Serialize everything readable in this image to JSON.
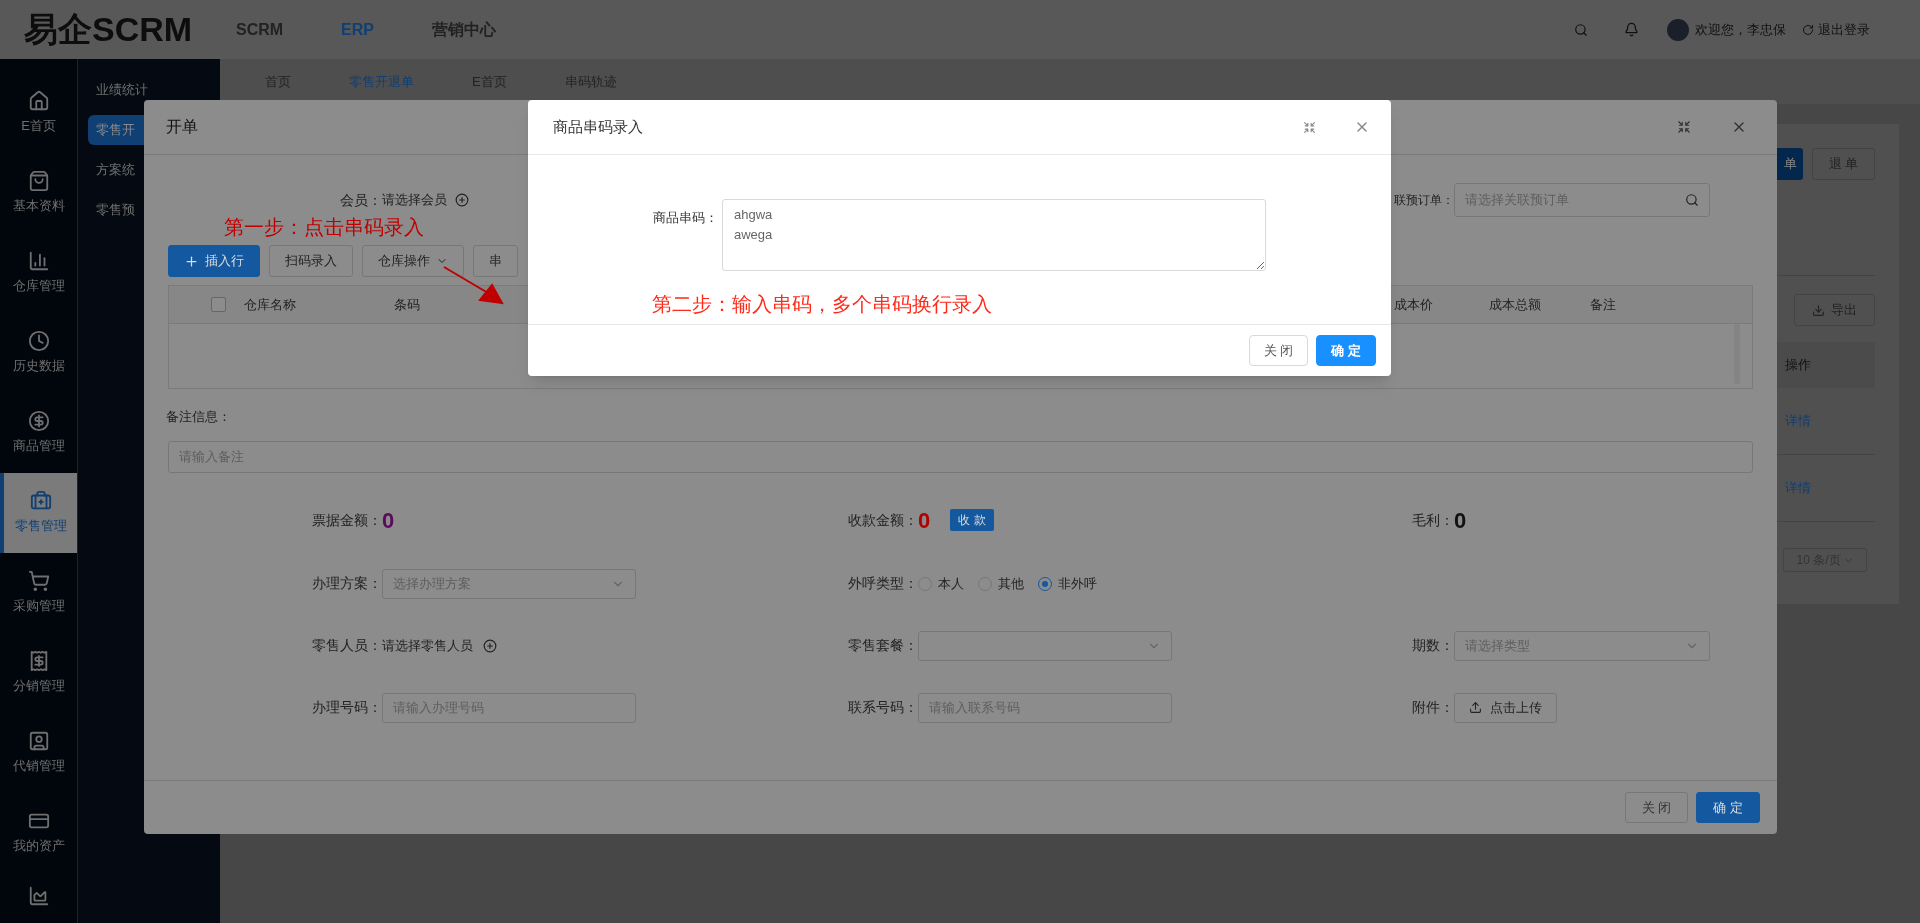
{
  "top_bar": {
    "logo": "易企SCRM",
    "nav": [
      {
        "label": "SCRM",
        "selected": false
      },
      {
        "label": "ERP",
        "selected": true
      },
      {
        "label": "营销中心",
        "selected": false
      }
    ],
    "greeting": "欢迎您，李忠保",
    "logout": "退出登录"
  },
  "sidebar": {
    "items": [
      {
        "label": "E首页",
        "selected": false
      },
      {
        "label": "基本资料",
        "selected": false
      },
      {
        "label": "仓库管理",
        "selected": false
      },
      {
        "label": "历史数据",
        "selected": false
      },
      {
        "label": "商品管理",
        "selected": false
      },
      {
        "label": "零售管理",
        "selected": true
      },
      {
        "label": "采购管理",
        "selected": false
      },
      {
        "label": "分销管理",
        "selected": false
      },
      {
        "label": "代销管理",
        "selected": false
      },
      {
        "label": "我的资产",
        "selected": false
      }
    ]
  },
  "sub_menu": [
    {
      "label": "业绩统计",
      "selected": false
    },
    {
      "label": "零售开",
      "selected": true
    },
    {
      "label": "方案统",
      "selected": false
    },
    {
      "label": "零售预",
      "selected": false
    }
  ],
  "tabs": [
    {
      "label": "首页",
      "selected": false
    },
    {
      "label": "零售开退单",
      "selected": true
    },
    {
      "label": "E首页",
      "selected": false
    },
    {
      "label": "串码轨迹",
      "selected": false
    }
  ],
  "background": {
    "buttons": [
      "单",
      "退 单"
    ],
    "export": "导出",
    "column": "操作",
    "links": [
      "详情",
      "详情"
    ],
    "page_size": "10 条/页"
  },
  "order_dialog": {
    "title": "开单",
    "member_label": "会员：",
    "member_value": "请选择会员",
    "preorder_label": "联预订单：",
    "preorder_placeholder": "请选择关联预订单",
    "annotation": "第一步：点击串码录入",
    "toolbar": [
      {
        "label": "插入行",
        "kind": "primary"
      },
      {
        "label": "扫码录入",
        "kind": "plain"
      },
      {
        "label": "仓库操作",
        "kind": "dropdown"
      },
      {
        "label": "串",
        "kind": "plain"
      }
    ],
    "select_all_checked": false,
    "table_columns_left": [
      "仓库名称",
      "条码"
    ],
    "table_columns_right": [
      "成本价",
      "成本总额",
      "备注"
    ],
    "note_label": "备注信息：",
    "note_placeholder": "请输入备注",
    "amounts": [
      {
        "label": "票据金额：",
        "value": "0",
        "color": "#5c0a5c"
      },
      {
        "label": "收款金额：",
        "value": "0",
        "color": "#b00000",
        "action": "收 款"
      },
      {
        "label": "毛利：",
        "value": "0",
        "color": "#111111"
      }
    ],
    "plan_label": "办理方案：",
    "plan_placeholder": "选择办理方案",
    "call_label": "外呼类型：",
    "call_options": [
      {
        "label": "本人",
        "selected": false
      },
      {
        "label": "其他",
        "selected": false
      },
      {
        "label": "非外呼",
        "selected": true
      }
    ],
    "staff_label": "零售人员：",
    "staff_value": "请选择零售人员",
    "package_label": "零售套餐：",
    "period_label": "期数：",
    "period_placeholder": "请选择类型",
    "number_label": "办理号码：",
    "number_placeholder": "请输入办理号码",
    "contact_label": "联系号码：",
    "contact_placeholder": "请输入联系号码",
    "attach_label": "附件：",
    "upload": "点击上传",
    "footer": [
      "关 闭",
      "确 定"
    ]
  },
  "serial_dialog": {
    "title": "商品串码录入",
    "label": "商品串码：",
    "value": "ahgwa\nawega",
    "annotation": "第二步：输入串码，多个串码换行录入",
    "footer": [
      "关 闭",
      "确 定"
    ]
  }
}
